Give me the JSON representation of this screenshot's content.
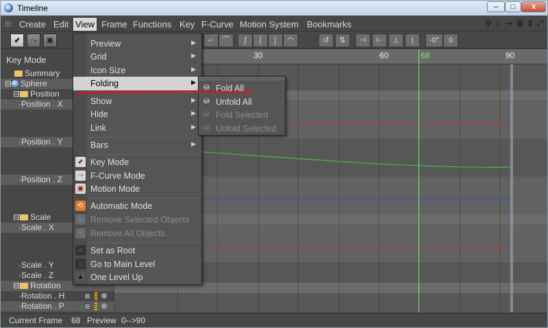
{
  "window": {
    "title": "Timeline",
    "controls": [
      "–",
      "□",
      "x"
    ]
  },
  "menubar": {
    "items": [
      "Create",
      "Edit",
      "View",
      "Frame",
      "Functions",
      "Key",
      "F-Curve",
      "Motion System",
      "Bookmarks"
    ],
    "active": "View",
    "right_icons": [
      "search-icon",
      "home-icon",
      "link-icon",
      "layout-icon",
      "scroll-icon",
      "expand-icon"
    ]
  },
  "toolbar": {
    "modes": [
      "key-mode-icon",
      "fcurve-mode-icon",
      "motion-mode-icon"
    ],
    "tools": [
      "linear-icon",
      "step-icon",
      "spline-icon",
      "ease-in-icon",
      "ease-out-icon",
      "ease-icon",
      "tangent-icon",
      "break-tangent-icon",
      "lock-tangent-icon",
      "zero-length-icon",
      "zero-angle-icon",
      "clamp-icon",
      "rotate-tangent-icon",
      "zero-icon"
    ],
    "zero_angle_label": "-0°",
    "zero_value_label": "0"
  },
  "left_panel": {
    "header": "Key Mode",
    "tree": [
      {
        "label": "Summary",
        "kind": "folder"
      },
      {
        "label": "Sphere",
        "kind": "object"
      },
      {
        "label": "Position",
        "kind": "folder"
      },
      {
        "label": "Position . X",
        "kind": "track"
      },
      {
        "label": "Position . Y",
        "kind": "track"
      },
      {
        "label": "Position . Z",
        "kind": "track"
      },
      {
        "label": "Scale",
        "kind": "folder"
      },
      {
        "label": "Scale . X",
        "kind": "track"
      },
      {
        "label": "Scale . Y",
        "kind": "track"
      },
      {
        "label": "Scale . Z",
        "kind": "track"
      },
      {
        "label": "Rotation",
        "kind": "folder"
      },
      {
        "label": "Rotation . H",
        "kind": "track"
      },
      {
        "label": "Rotation . P",
        "kind": "track"
      }
    ]
  },
  "timeline": {
    "ruler_labels": [
      "30",
      "60",
      "90"
    ],
    "current_frame_label": "68",
    "colors": {
      "x_curve": "#c03030",
      "y_curve": "#3dbf3d",
      "z_curve": "#3050c8",
      "current": "#7de07d"
    }
  },
  "view_menu": {
    "items": [
      {
        "label": "Preview",
        "submenu": true
      },
      {
        "label": "Grid",
        "submenu": true
      },
      {
        "label": "Icon Size",
        "submenu": true
      },
      {
        "label": "Folding",
        "submenu": true,
        "highlighted": true
      },
      {
        "label": "Show",
        "submenu": true
      },
      {
        "label": "Hide",
        "submenu": true
      },
      {
        "label": "Link",
        "submenu": true
      },
      {
        "label": "Bars",
        "submenu": true
      },
      {
        "label": "Key Mode",
        "icon": "key-mode-icon"
      },
      {
        "label": "F-Curve Mode",
        "icon": "fcurve-mode-icon"
      },
      {
        "label": "Motion Mode",
        "icon": "motion-mode-icon"
      },
      {
        "label": "Automatic Mode",
        "icon": "auto-mode-icon"
      },
      {
        "label": "Remove Selected Objects",
        "icon": "remove-selected-icon",
        "disabled": true
      },
      {
        "label": "Remove All Objects",
        "icon": "remove-all-icon",
        "disabled": true
      },
      {
        "label": "Set as Root",
        "icon": "set-root-icon"
      },
      {
        "label": "Go to Main Level",
        "icon": "main-level-icon"
      },
      {
        "label": "One Level Up",
        "icon": "level-up-icon"
      }
    ]
  },
  "folding_submenu": {
    "items": [
      {
        "label": "Fold All",
        "icon": "fold-all-icon"
      },
      {
        "label": "Unfold All",
        "icon": "unfold-all-icon"
      },
      {
        "label": "Fold Selected",
        "icon": "fold-selected-icon",
        "disabled": true
      },
      {
        "label": "Unfold Selected",
        "icon": "unfold-selected-icon",
        "disabled": true
      }
    ]
  },
  "status": {
    "frame_label": "Current Frame",
    "frame_value": "68",
    "preview_label": "Preview",
    "preview_value": "0-->90"
  }
}
